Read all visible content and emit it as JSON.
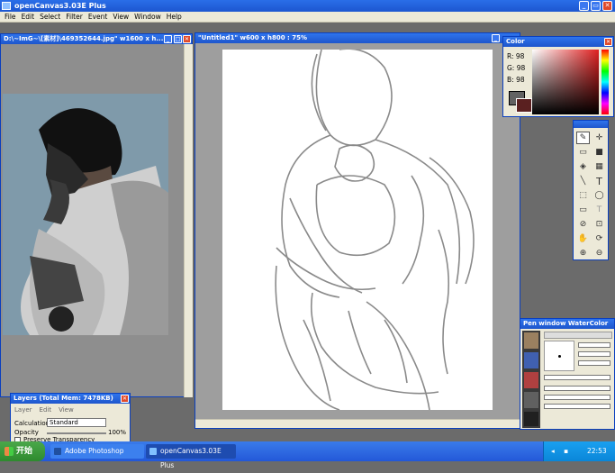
{
  "app": {
    "title": "openCanvas3.03E Plus"
  },
  "menu": [
    "File",
    "Edit",
    "Select",
    "Filter",
    "Event",
    "View",
    "Window",
    "Help"
  ],
  "image_window": {
    "title": "D:\\~ImG~\\[素材]\\469352644.jpg\" w1600 x h..."
  },
  "canvas_window": {
    "title": "\"Untitled1\" w600 x h800 : 75%"
  },
  "color_panel": {
    "title": "Color",
    "r_label": "R:",
    "r": "98",
    "g_label": "G:",
    "g": "98",
    "b_label": "B:",
    "b": "98"
  },
  "layers_panel": {
    "title": "Layers (Total Mem: 7478KB)",
    "menu": [
      "Layer",
      "Edit",
      "View"
    ],
    "calc_label": "Calculation",
    "calc_value": "Standard",
    "opacity_label": "Opacity",
    "opacity_value": "100%",
    "preserve_label": "Preserve Transparency"
  },
  "pen_panel": {
    "title": "Pen window  WaterColor"
  },
  "taskbar": {
    "start": "开始",
    "tasks": [
      "Adobe Photoshop",
      "openCanvas3.03E Plus"
    ],
    "time": "22:53"
  },
  "window_controls": {
    "minimize": "_",
    "maximize": "□",
    "restore": "▭",
    "close": "✕"
  },
  "tools": {
    "brush": "✎",
    "move": "✛",
    "transform": "▭",
    "color_block": "■",
    "fill": "◈",
    "gradient": "▦",
    "line": "╲",
    "text": "T",
    "select_rect": "⬚",
    "lasso": "◯",
    "marquee": "▭",
    "text_alt": "T",
    "eyedrop": "⊘",
    "crop": "⊡",
    "hand": "✋",
    "rotate": "⟳",
    "zoom_in": "⊕",
    "zoom_out": "⊖"
  },
  "colors": {
    "title_blue": "#2a6ee8",
    "panel_bg": "#ece9d8",
    "photo_bg": "#7f9aaa",
    "close_red": "#e04a2a",
    "taskbar_green": "#2e8a2e"
  }
}
